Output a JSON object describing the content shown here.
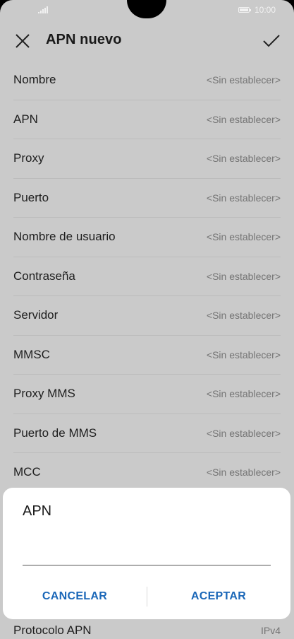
{
  "status_bar": {
    "time": "10:00",
    "signal_icon": "signal-icon",
    "battery_icon": "battery-icon"
  },
  "toolbar": {
    "title": "APN nuevo",
    "close_icon": "close-icon",
    "confirm_icon": "check-icon"
  },
  "fields": [
    {
      "label": "Nombre",
      "value": "<Sin establecer>"
    },
    {
      "label": "APN",
      "value": "<Sin establecer>"
    },
    {
      "label": "Proxy",
      "value": "<Sin establecer>"
    },
    {
      "label": "Puerto",
      "value": "<Sin establecer>"
    },
    {
      "label": "Nombre de usuario",
      "value": "<Sin establecer>"
    },
    {
      "label": "Contraseña",
      "value": "<Sin establecer>"
    },
    {
      "label": "Servidor",
      "value": "<Sin establecer>"
    },
    {
      "label": "MMSC",
      "value": "<Sin establecer>"
    },
    {
      "label": "Proxy MMS",
      "value": "<Sin establecer>"
    },
    {
      "label": "Puerto de MMS",
      "value": "<Sin establecer>"
    },
    {
      "label": "MCC",
      "value": "<Sin establecer>"
    }
  ],
  "bottom_field": {
    "label": "Protocolo APN",
    "value": "IPv4"
  },
  "dialog": {
    "title": "APN",
    "input_value": "",
    "cancel_label": "CANCELAR",
    "accept_label": "ACEPTAR"
  },
  "colors": {
    "accent": "#1a67b8",
    "scrim_background": "#cacaca",
    "dialog_background": "#ffffff"
  }
}
